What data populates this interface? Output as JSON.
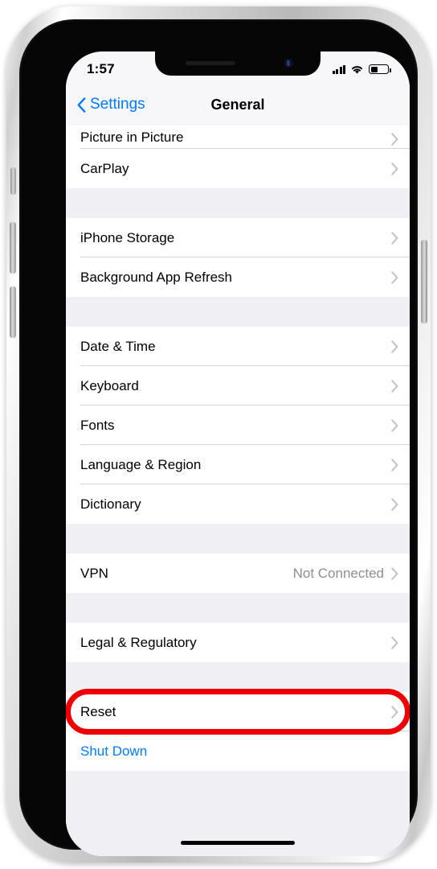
{
  "status_bar": {
    "time": "1:57",
    "cellular_icon": "cellular-bars-icon",
    "wifi_icon": "wifi-icon",
    "battery_icon": "battery-icon",
    "battery_level_percent": 38
  },
  "nav_bar": {
    "back_label": "Settings",
    "back_icon": "chevron-left-icon",
    "title": "General"
  },
  "sections": [
    {
      "rows": [
        {
          "label": "Picture in Picture",
          "value": "",
          "clipped": true,
          "accessory": "chevron-right-icon",
          "style": "default"
        },
        {
          "label": "CarPlay",
          "value": "",
          "clipped": false,
          "accessory": "chevron-right-icon",
          "style": "default"
        }
      ]
    },
    {
      "rows": [
        {
          "label": "iPhone Storage",
          "value": "",
          "clipped": false,
          "accessory": "chevron-right-icon",
          "style": "default"
        },
        {
          "label": "Background App Refresh",
          "value": "",
          "clipped": false,
          "accessory": "chevron-right-icon",
          "style": "default"
        }
      ]
    },
    {
      "rows": [
        {
          "label": "Date & Time",
          "value": "",
          "clipped": false,
          "accessory": "chevron-right-icon",
          "style": "default"
        },
        {
          "label": "Keyboard",
          "value": "",
          "clipped": false,
          "accessory": "chevron-right-icon",
          "style": "default"
        },
        {
          "label": "Fonts",
          "value": "",
          "clipped": false,
          "accessory": "chevron-right-icon",
          "style": "default"
        },
        {
          "label": "Language & Region",
          "value": "",
          "clipped": false,
          "accessory": "chevron-right-icon",
          "style": "default"
        },
        {
          "label": "Dictionary",
          "value": "",
          "clipped": false,
          "accessory": "chevron-right-icon",
          "style": "default"
        }
      ]
    },
    {
      "rows": [
        {
          "label": "VPN",
          "value": "Not Connected",
          "clipped": false,
          "accessory": "chevron-right-icon",
          "style": "default"
        }
      ]
    },
    {
      "rows": [
        {
          "label": "Legal & Regulatory",
          "value": "",
          "clipped": false,
          "accessory": "chevron-right-icon",
          "style": "default"
        }
      ]
    },
    {
      "rows": [
        {
          "label": "Reset",
          "value": "",
          "clipped": false,
          "accessory": "chevron-right-icon",
          "style": "default"
        },
        {
          "label": "Shut Down",
          "value": "",
          "clipped": false,
          "accessory": "none",
          "style": "blue"
        }
      ]
    }
  ],
  "annotation": {
    "shape": "oval",
    "color": "#ee0000",
    "stroke_width": 7,
    "targets_row_label": "Reset"
  },
  "colors": {
    "accent_blue": "#007aff",
    "group_background": "#efeff4",
    "row_background": "#ffffff",
    "separator": "#d4d4d8",
    "secondary_text": "#8e8e93",
    "annotation_red": "#ee0000"
  },
  "home_indicator": "home-indicator-bar"
}
